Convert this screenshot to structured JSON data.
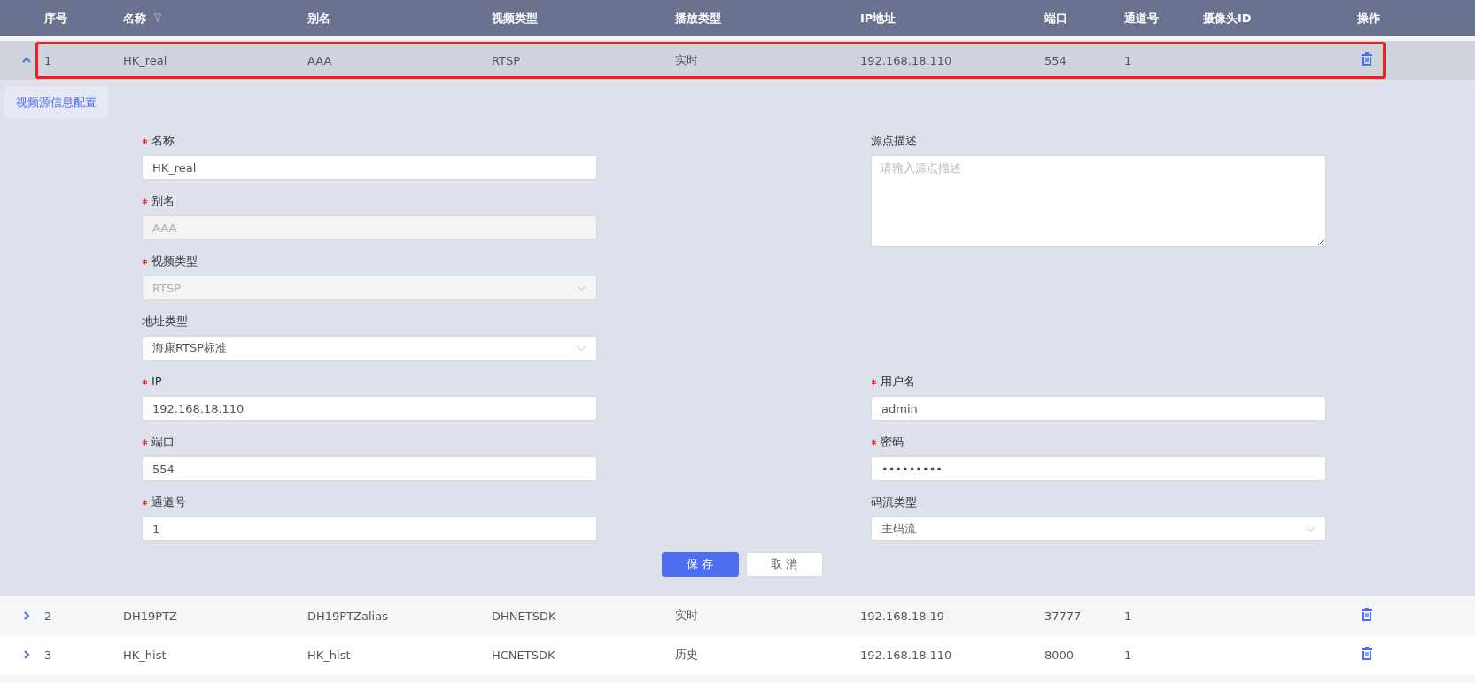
{
  "table": {
    "columns": [
      {
        "label": "序号",
        "filter": false
      },
      {
        "label": "名称",
        "filter": true
      },
      {
        "label": "别名",
        "filter": false
      },
      {
        "label": "视频类型",
        "filter": false
      },
      {
        "label": "播放类型",
        "filter": false
      },
      {
        "label": "IP地址",
        "filter": false
      },
      {
        "label": "端口",
        "filter": false
      },
      {
        "label": "通道号",
        "filter": false
      },
      {
        "label": "摄像头ID",
        "filter": false
      },
      {
        "label": "操作",
        "filter": false
      }
    ],
    "rows": [
      {
        "expanded": true,
        "highlighted": true,
        "cells": [
          "1",
          "HK_real",
          "AAA",
          "RTSP",
          "实时",
          "192.168.18.110",
          "554",
          "1",
          ""
        ]
      },
      {
        "expanded": false,
        "highlighted": false,
        "cells": [
          "2",
          "DH19PTZ",
          "DH19PTZalias",
          "DHNETSDK",
          "实时",
          "192.168.18.19",
          "37777",
          "1",
          ""
        ]
      },
      {
        "expanded": false,
        "highlighted": false,
        "cells": [
          "3",
          "HK_hist",
          "HK_hist",
          "HCNETSDK",
          "历史",
          "192.168.18.110",
          "8000",
          "1",
          ""
        ]
      }
    ]
  },
  "detail": {
    "tabs": [
      {
        "label": "视频源信息配置",
        "selected": true
      }
    ],
    "left_fields": [
      {
        "label": "名称",
        "required": true,
        "kind": "text",
        "disabled": false,
        "value": "HK_real"
      },
      {
        "label": "别名",
        "required": true,
        "kind": "text",
        "disabled": true,
        "value": "AAA"
      },
      {
        "label": "视频类型",
        "required": true,
        "kind": "select",
        "disabled": true,
        "value": "RTSP"
      },
      {
        "label": "地址类型",
        "required": false,
        "kind": "select",
        "disabled": false,
        "value": "海康RTSP标准"
      },
      {
        "label": "IP",
        "required": true,
        "kind": "text",
        "disabled": false,
        "value": "192.168.18.110"
      },
      {
        "label": "端口",
        "required": true,
        "kind": "text",
        "disabled": false,
        "value": "554"
      },
      {
        "label": "通道号",
        "required": true,
        "kind": "text",
        "disabled": false,
        "value": "1"
      }
    ],
    "description": {
      "label": "源点描述",
      "required": false,
      "kind": "textarea",
      "placeholder": "请输入源点描述"
    },
    "right_fields": [
      {
        "label": "用户名",
        "required": true,
        "kind": "text",
        "disabled": false,
        "value": "admin"
      },
      {
        "label": "密码",
        "required": true,
        "kind": "password",
        "disabled": false,
        "value": "•••••••••"
      },
      {
        "label": "码流类型",
        "required": false,
        "kind": "select",
        "disabled": false,
        "value": "主码流"
      }
    ],
    "buttons": [
      {
        "label": "保 存",
        "kind": "primary"
      },
      {
        "label": "取 消",
        "kind": "default"
      }
    ]
  }
}
